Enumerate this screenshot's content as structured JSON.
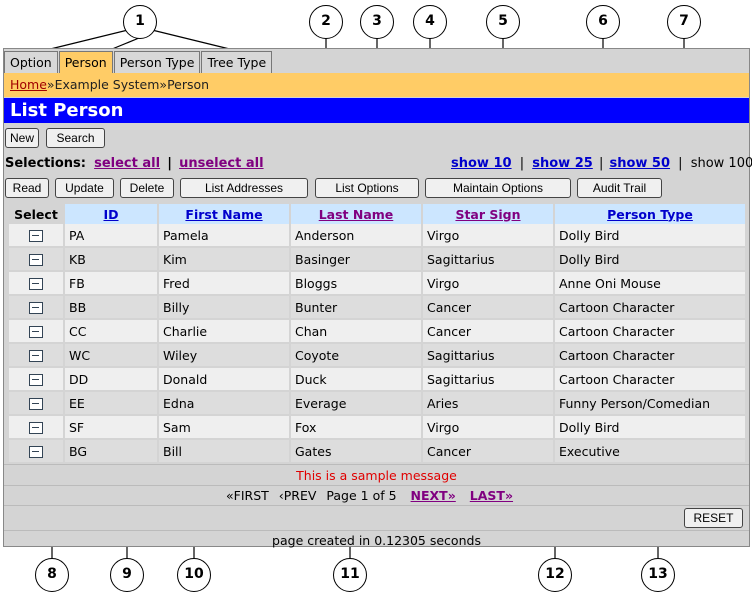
{
  "tabs": [
    {
      "label": "Option",
      "active": false
    },
    {
      "label": "Person",
      "active": true
    },
    {
      "label": "Person Type",
      "active": false
    },
    {
      "label": "Tree Type",
      "active": false
    }
  ],
  "breadcrumb": {
    "home": "Home",
    "sep1": "»",
    "system": "Example System",
    "sep2": "»",
    "current": "Person"
  },
  "page_title": "List Person",
  "top_buttons": {
    "new": "New",
    "search": "Search"
  },
  "selections": {
    "label": "Selections:",
    "select_all": "select all",
    "divider": "|",
    "unselect_all": "unselect all"
  },
  "show": {
    "show10": "show 10",
    "show25": "show 25",
    "show50": "show 50",
    "show100": "show 100",
    "divider": "|"
  },
  "action_buttons": {
    "read": "Read",
    "update": "Update",
    "delete": "Delete",
    "list_addresses": "List Addresses",
    "list_options": "List Options",
    "maintain_options": "Maintain Options",
    "audit_trail": "Audit Trail"
  },
  "columns": {
    "select": "Select",
    "id": "ID",
    "first_name": "First Name",
    "last_name": "Last Name",
    "star_sign": "Star Sign",
    "person_type": "Person Type"
  },
  "rows": [
    [
      "PA",
      "Pamela",
      "Anderson",
      "Virgo",
      "Dolly Bird"
    ],
    [
      "KB",
      "Kim",
      "Basinger",
      "Sagittarius",
      "Dolly Bird"
    ],
    [
      "FB",
      "Fred",
      "Bloggs",
      "Virgo",
      "Anne Oni Mouse"
    ],
    [
      "BB",
      "Billy",
      "Bunter",
      "Cancer",
      "Cartoon Character"
    ],
    [
      "CC",
      "Charlie",
      "Chan",
      "Cancer",
      "Cartoon Character"
    ],
    [
      "WC",
      "Wiley",
      "Coyote",
      "Sagittarius",
      "Cartoon Character"
    ],
    [
      "DD",
      "Donald",
      "Duck",
      "Sagittarius",
      "Cartoon Character"
    ],
    [
      "EE",
      "Edna",
      "Everage",
      "Aries",
      "Funny Person/Comedian"
    ],
    [
      "SF",
      "Sam",
      "Fox",
      "Virgo",
      "Dolly Bird"
    ],
    [
      "BG",
      "Bill",
      "Gates",
      "Cancer",
      "Executive"
    ]
  ],
  "message": "This is a sample message",
  "pager": {
    "first": "«FIRST",
    "prev": "‹PREV",
    "page": "Page 1 of 5",
    "next": "NEXT»",
    "last": "LAST»"
  },
  "reset": "RESET",
  "created": "page created in 0.12305 seconds",
  "callouts": [
    "1",
    "2",
    "3",
    "4",
    "5",
    "6",
    "7",
    "8",
    "9",
    "10",
    "11",
    "12",
    "13"
  ],
  "colors": {
    "tab_active": "#ffcc66",
    "title_bar": "#0000ff",
    "header_bg": "#cce6ff",
    "message": "#e00000"
  }
}
